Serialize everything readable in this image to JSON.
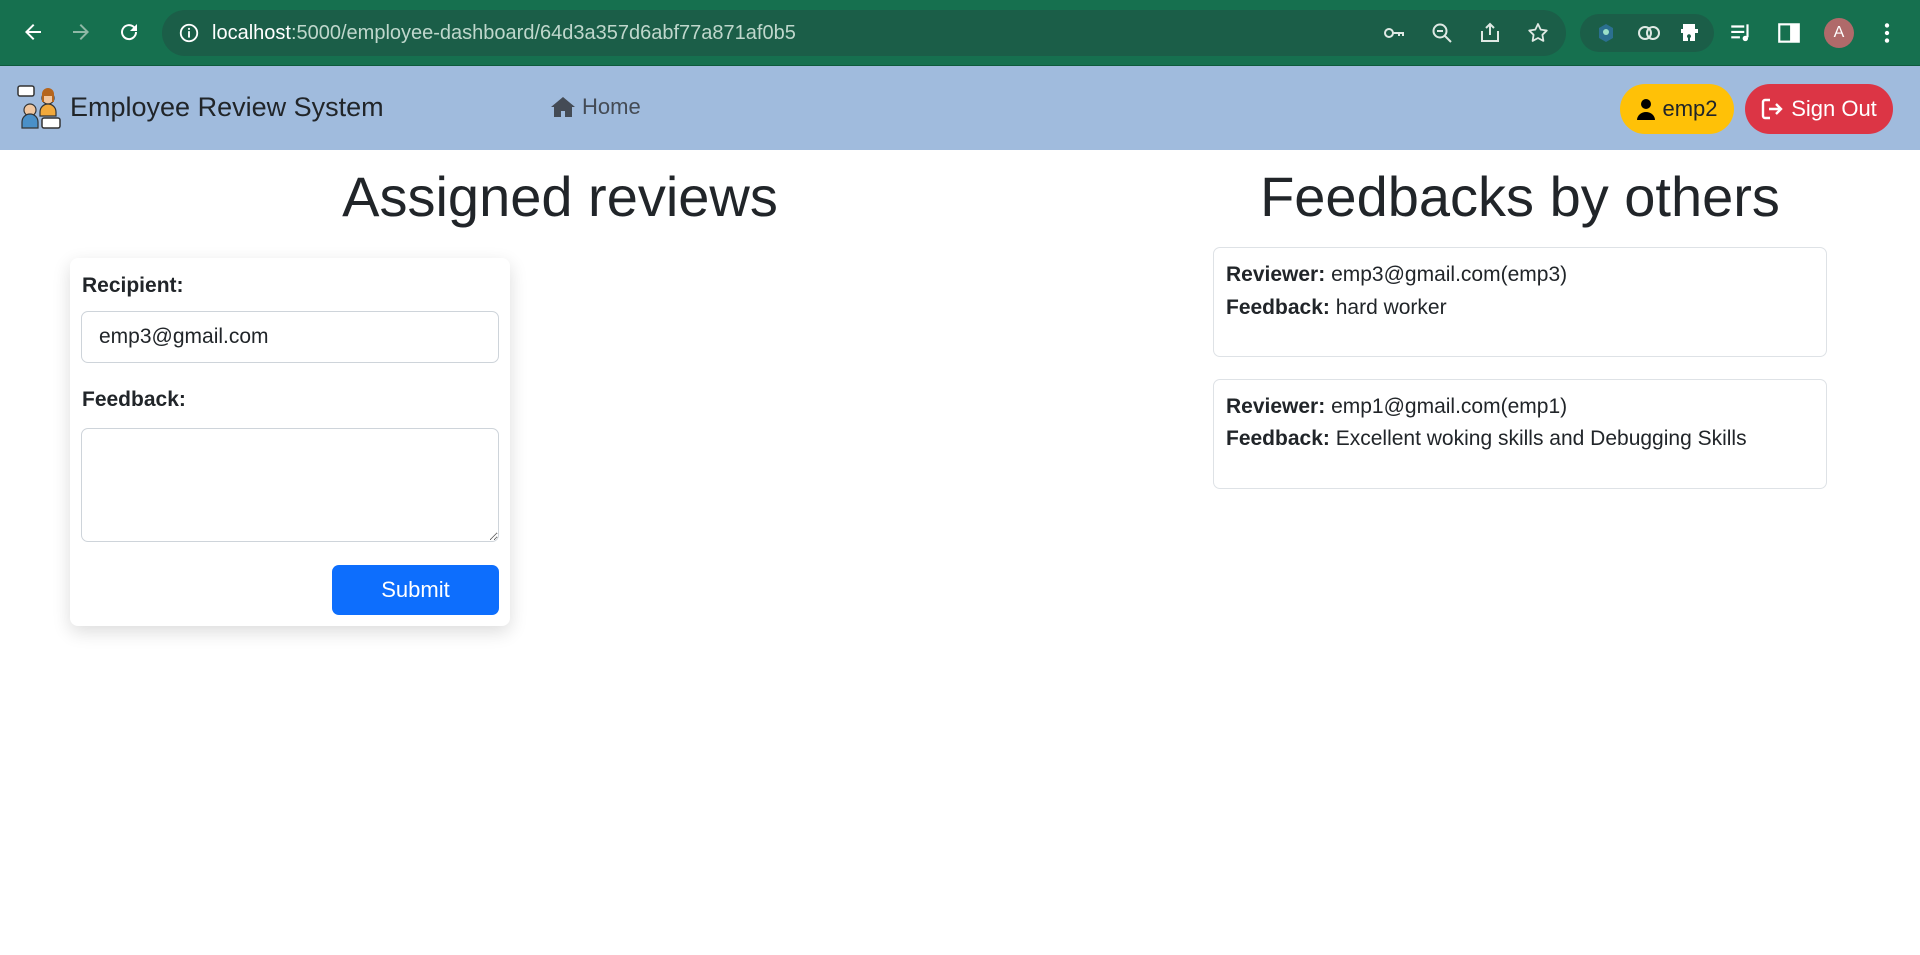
{
  "browser": {
    "url_host": "localhost",
    "url_path": ":5000/employee-dashboard/64d3a357d6abf77a871af0b5",
    "profile_initial": "A",
    "icons": [
      "back-arrow-icon",
      "forward-arrow-icon",
      "reload-icon",
      "info-icon",
      "key-icon",
      "zoom-out-icon",
      "share-icon",
      "star-icon",
      "extension-icon",
      "puzzle-icon",
      "media-icon",
      "side-panel-icon",
      "more-vert-icon"
    ]
  },
  "navbar": {
    "brand": "Employee Review System",
    "home_label": "Home",
    "user_label": "emp2",
    "signout_label": "Sign Out",
    "colors": {
      "bar": "#a0bbdd",
      "user": "#ffc107",
      "signout": "#dc3545"
    }
  },
  "assigned": {
    "title": "Assigned reviews",
    "recipient_label": "Recipient:",
    "recipient_value": "emp3@gmail.com",
    "feedback_label": "Feedback:",
    "feedback_value": "",
    "submit_label": "Submit",
    "submit_color": "#0d6efd"
  },
  "others": {
    "title": "Feedbacks by others",
    "reviewer_label": "Reviewer:",
    "feedback_label": "Feedback:",
    "items": [
      {
        "reviewer": "emp3@gmail.com(emp3)",
        "feedback": "hard worker"
      },
      {
        "reviewer": "emp1@gmail.com(emp1)",
        "feedback": "Excellent woking skills and Debugging Skills"
      }
    ]
  }
}
